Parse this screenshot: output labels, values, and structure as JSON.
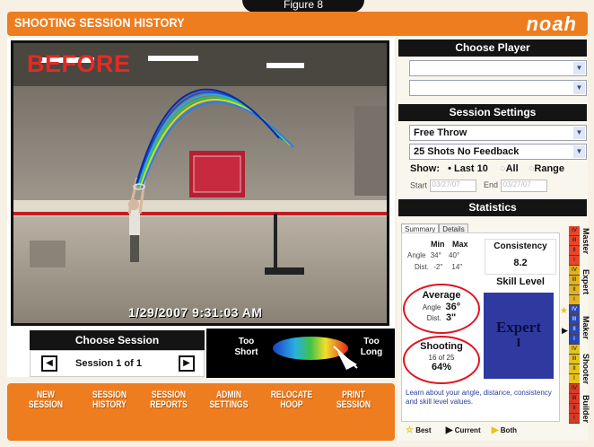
{
  "figure_label": "Figure 8",
  "header": {
    "title": "SHOOTING SESSION HISTORY",
    "logo": "noah"
  },
  "video": {
    "overlay_label": "BEFORE",
    "timestamp": "1/29/2007 9:31:03 AM"
  },
  "session": {
    "header": "Choose Session",
    "prev_icon": "◀",
    "next_icon": "▶",
    "label": "Session 1 of 1"
  },
  "range_legend": {
    "short_label": "Too Short",
    "long_label": "Too Long"
  },
  "bottom_nav": [
    {
      "line1": "NEW",
      "line2": "SESSION"
    },
    {
      "line1": "SESSION",
      "line2": "HISTORY"
    },
    {
      "line1": "SESSION",
      "line2": "REPORTS"
    },
    {
      "line1": "ADMIN",
      "line2": "SETTINGS"
    },
    {
      "line1": "RELOCATE",
      "line2": "HOOP"
    },
    {
      "line1": "PRINT",
      "line2": "SESSION"
    }
  ],
  "choose_player": {
    "header": "Choose Player",
    "select1": "",
    "select2": ""
  },
  "session_settings": {
    "header": "Session Settings",
    "shot_type": "Free Throw",
    "mode": "25 Shots No Feedback",
    "show_label": "Show:",
    "show_options": [
      "• Last 10",
      "All",
      "Range"
    ],
    "start_label": "Start",
    "start_value": "03/27/07",
    "end_label": "End",
    "end_value": "03/27/07"
  },
  "statistics": {
    "header": "Statistics",
    "tabs": [
      "Summary",
      "Details"
    ],
    "minmax": {
      "min_header": "Min",
      "max_header": "Max",
      "angle_label": "Angle",
      "angle_min": "34°",
      "angle_max": "40°",
      "dist_label": "Dist.",
      "dist_min": "-2\"",
      "dist_max": "14\""
    },
    "consistency": {
      "label": "Consistency",
      "value": "8.2"
    },
    "skill_level": {
      "label": "Skill Level",
      "value_line1": "Expert",
      "value_line2": "I"
    },
    "average": {
      "label": "Average",
      "angle_label": "Angle",
      "angle_value": "36°",
      "dist_label": "Dist.",
      "dist_value": "3\""
    },
    "shooting": {
      "label": "Shooting",
      "made": "16 of 25",
      "percent": "64%"
    },
    "learn_text": "Learn about your angle, distance, consistency and skill level values.",
    "key": {
      "best": "Best",
      "current": "Current",
      "both": "Both"
    }
  },
  "skill_ladder": {
    "labels": [
      "Master",
      "Expert",
      "Maker",
      "Shooter",
      "Builder"
    ],
    "levels": [
      "IV",
      "III",
      "II",
      "I",
      "IV",
      "III",
      "II",
      "I",
      "IV",
      "III",
      "II",
      "I",
      "IV",
      "III",
      "II",
      "I",
      "IV",
      "III",
      "II",
      "I"
    ],
    "colors": {
      "master": "#e8452a",
      "expert": "#e2b21c",
      "maker": "#2b46b8",
      "shooter": "#e6c21c",
      "builder": "#d83a26"
    }
  }
}
